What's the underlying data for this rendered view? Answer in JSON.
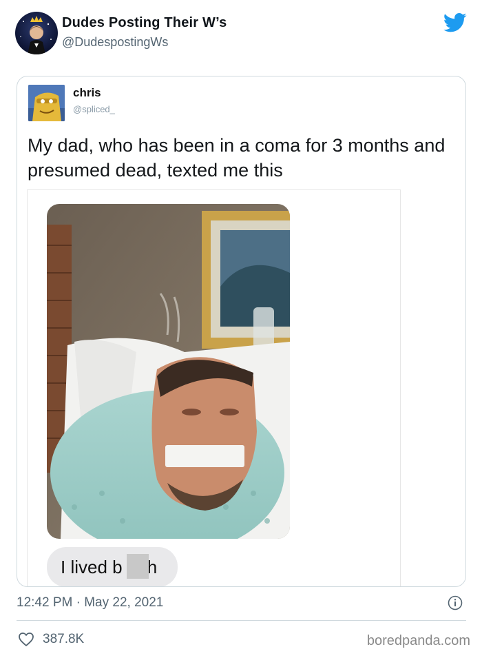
{
  "tweet": {
    "display_name": "Dudes Posting Their W’s",
    "handle": "@DudespostingWs",
    "timestamp": "12:42 PM · May 22, 2021",
    "likes": "387.8K"
  },
  "quoted_tweet": {
    "name": "chris",
    "handle": "@spliced_",
    "text": "My dad, who has been in a coma for 3 months and presumed dead, texted me this",
    "message_text": "I lived b     h"
  },
  "watermark": "boredpanda.com",
  "icons": {
    "brand": "twitter-bird-icon",
    "info": "info-icon",
    "like": "heart-icon"
  },
  "colors": {
    "twitter_blue": "#1d9bf0",
    "secondary_text": "#536471",
    "border": "#cfd9de"
  }
}
